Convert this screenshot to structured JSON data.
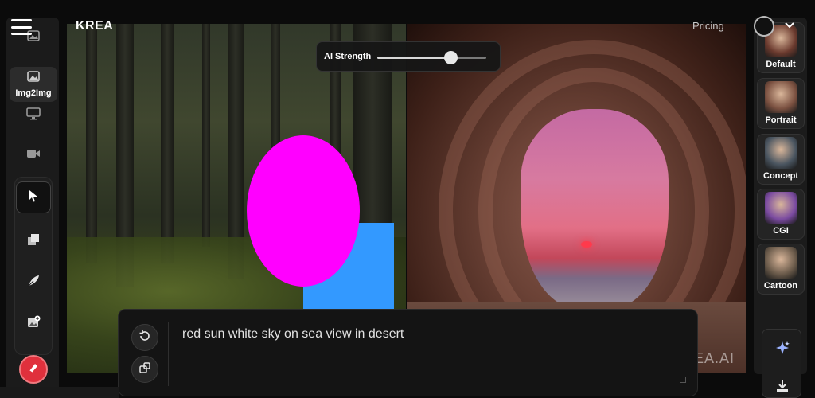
{
  "header": {
    "logo": "KREA",
    "pricing_label": "Pricing"
  },
  "sidebar": {
    "items": [
      {
        "label": "",
        "icon": "image-icon"
      },
      {
        "label": "Img2Img",
        "icon": "image-icon"
      },
      {
        "label": "",
        "icon": "screen-icon"
      },
      {
        "label": "",
        "icon": "video-icon"
      }
    ],
    "tools": [
      "pointer-icon",
      "layers-icon",
      "feather-icon",
      "image-add-icon"
    ],
    "erase_icon": "eraser-icon"
  },
  "ai_strength": {
    "label": "AI Strength",
    "value": 0.67
  },
  "styles": [
    {
      "name": "Default",
      "color": "#6b3a2e"
    },
    {
      "name": "Portrait",
      "color": "#7a5040"
    },
    {
      "name": "Concept",
      "color": "#4a5560"
    },
    {
      "name": "CGI",
      "color": "#7a4aa0"
    },
    {
      "name": "Cartoon",
      "color": "#6a5a4a"
    }
  ],
  "prompt": {
    "text": "red sun  white sky on sea view in desert"
  },
  "canvas": {
    "watermark": "EA.AI"
  },
  "colors": {
    "accent_red": "#e0303c",
    "shape_magenta": "#ff00ff",
    "shape_blue": "#3399ff"
  }
}
